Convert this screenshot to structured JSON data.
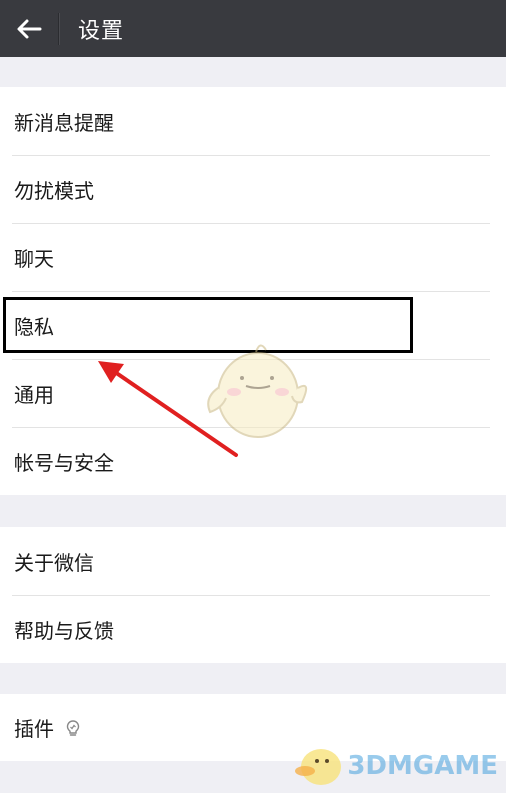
{
  "header": {
    "title": "设置"
  },
  "groups": {
    "main": [
      "新消息提醒",
      "勿扰模式",
      "聊天",
      "隐私",
      "通用",
      "帐号与安全"
    ],
    "about": [
      "关于微信",
      "帮助与反馈"
    ],
    "plugins": [
      "插件"
    ]
  },
  "colors": {
    "topbar": "#393a3f",
    "background": "#efeff4",
    "highlight_box": "#000000",
    "arrow": "#e02020"
  },
  "annotation": {
    "highlighted_item": "隐私"
  },
  "watermark": {
    "text": "3DMGAME"
  }
}
